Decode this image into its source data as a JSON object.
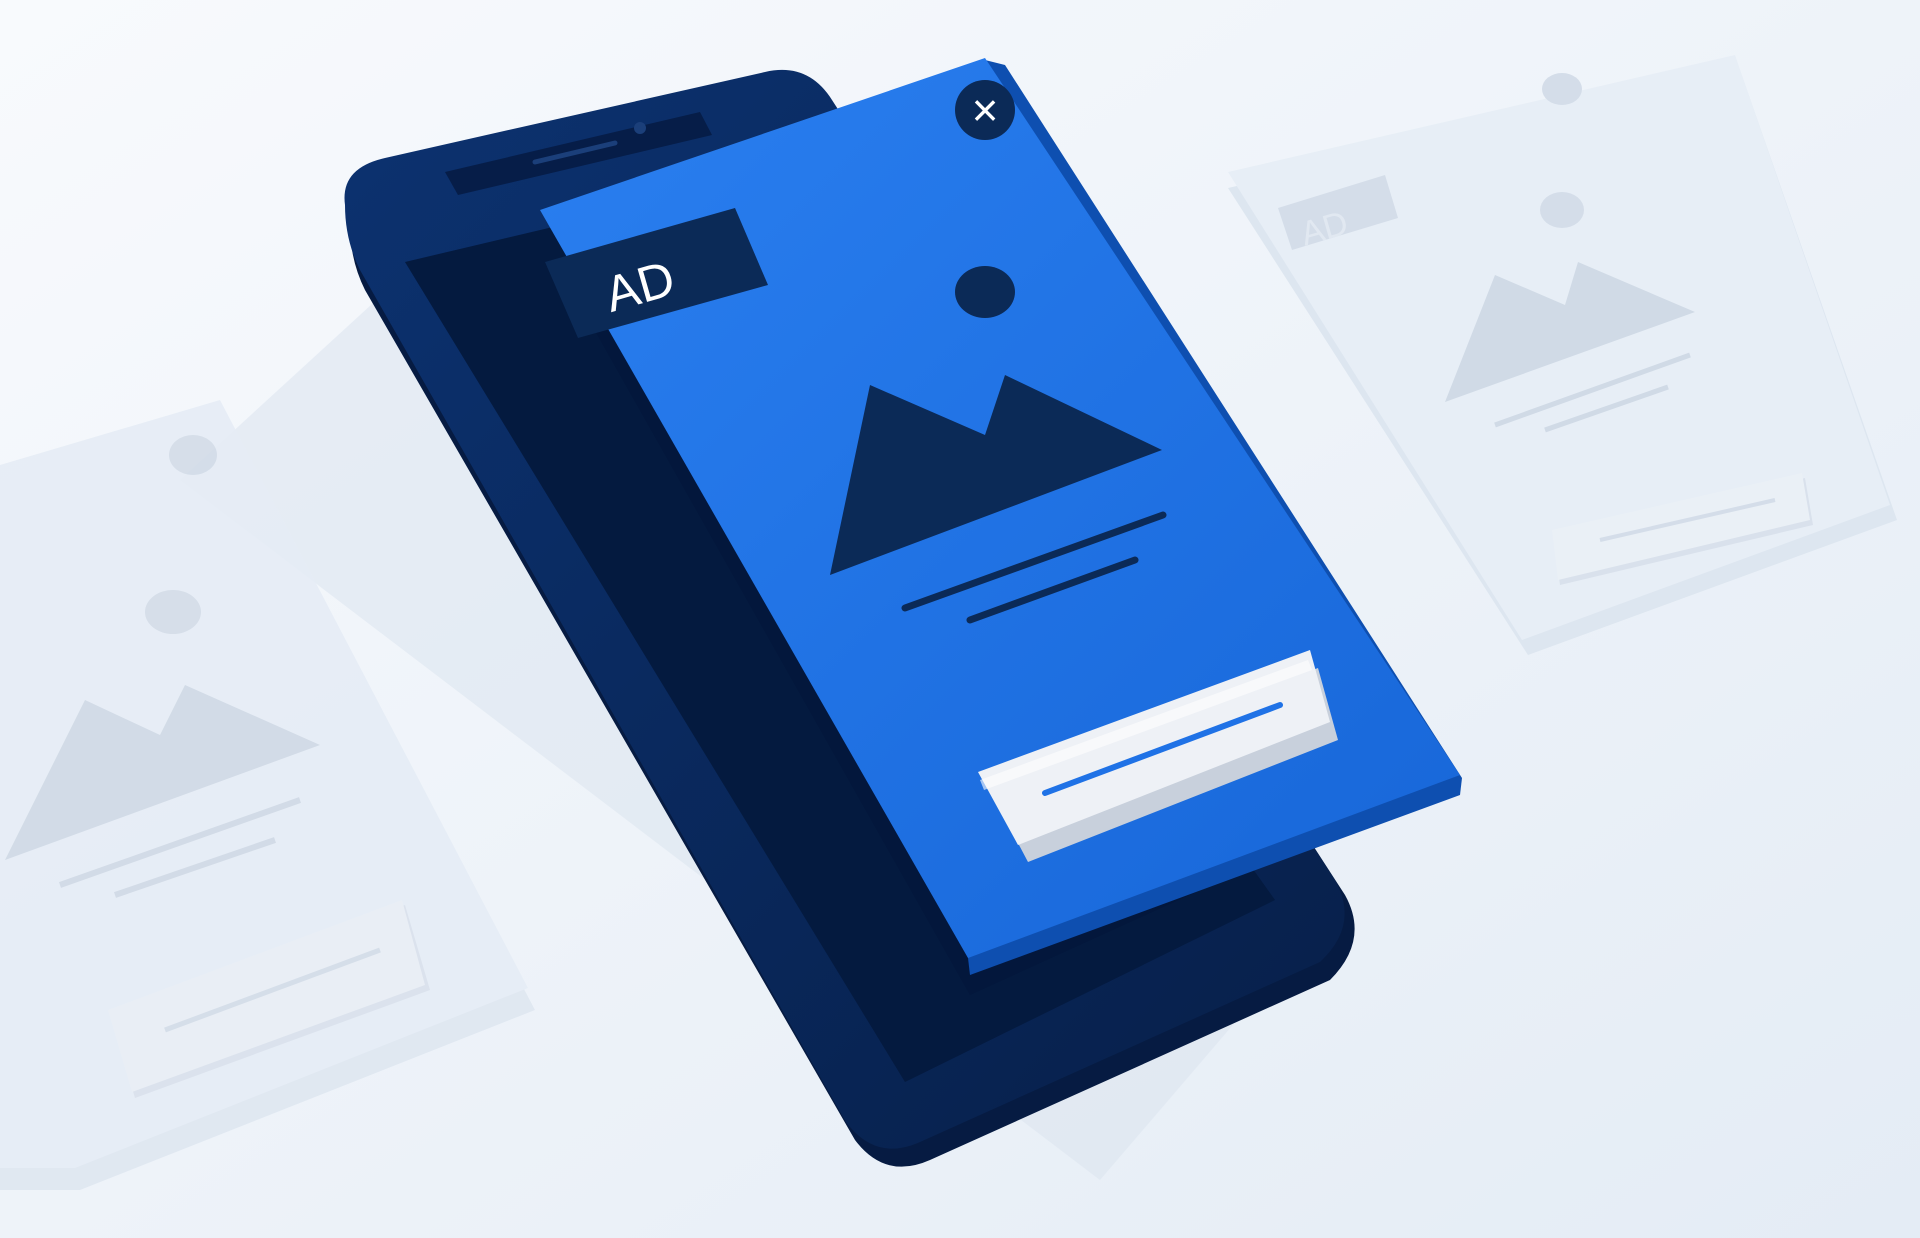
{
  "ad_popup": {
    "badge_label": "AD",
    "close_glyph": "×",
    "close_icon": "close-icon",
    "image_icon": "mountain-image-icon"
  },
  "ghost_left_card": {
    "image_icon": "mountain-image-icon"
  },
  "ghost_right_card": {
    "badge_label": "AD",
    "image_icon": "mountain-image-icon"
  },
  "colors": {
    "background": "#eef3f9",
    "phone_body": "#0a2a5c",
    "phone_screen": "#041a3f",
    "ad_blue": "#1f72e6",
    "ad_navy": "#0b2a57",
    "button_fill": "#eef1f6",
    "button_accent": "#1f72e6",
    "ghost_card": "#e3eaf3",
    "ghost_detail": "#cdd7e3"
  }
}
